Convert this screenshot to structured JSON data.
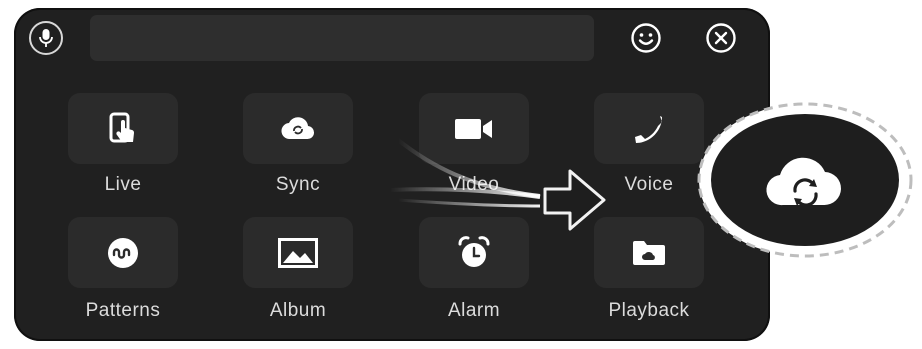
{
  "toolbar": {
    "input_value": "",
    "input_placeholder": ""
  },
  "apps": [
    {
      "label": "Live",
      "icon": "live-touch-icon"
    },
    {
      "label": "Sync",
      "icon": "cloud-sync-icon"
    },
    {
      "label": "Video",
      "icon": "video-camera-icon"
    },
    {
      "label": "Voice",
      "icon": "phone-icon"
    },
    {
      "label": "Patterns",
      "icon": "patterns-wave-icon"
    },
    {
      "label": "Album",
      "icon": "image-icon"
    },
    {
      "label": "Alarm",
      "icon": "alarm-clock-icon"
    },
    {
      "label": "Playback",
      "icon": "folder-cloud-icon"
    }
  ],
  "callout": {
    "icon": "cloud-sync-icon"
  },
  "colors": {
    "panel": "#202020",
    "tile": "#2b2b2b",
    "text": "#dcdcdc",
    "icon": "#ffffff",
    "callout": "#1e1e1e",
    "dashed_ring": "#bdbdbd"
  }
}
